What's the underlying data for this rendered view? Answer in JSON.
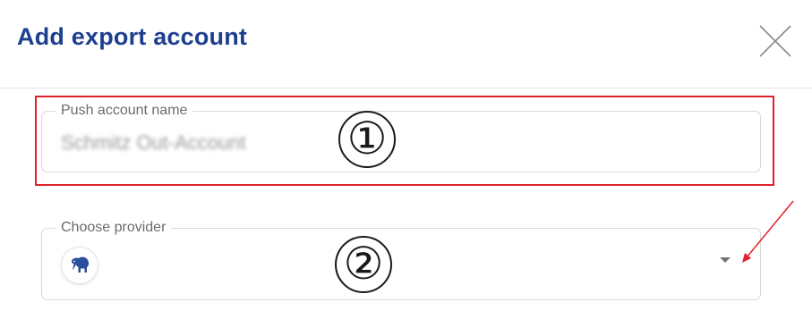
{
  "dialog": {
    "title": "Add export account",
    "close_icon": "close-icon"
  },
  "fields": {
    "account_name": {
      "label": "Push account name",
      "value": "Schmitz Out-Account"
    },
    "provider": {
      "label": "Choose provider",
      "selected_icon": "elephant-provider-icon",
      "dropdown_icon": "dropdown-arrow-icon"
    }
  },
  "annotations": {
    "callout_1": "①",
    "callout_2": "②",
    "highlight_color": "#e0212b",
    "arrow_color": "#e0212b"
  },
  "colors": {
    "title": "#1e3f8f",
    "icon_blue": "#2a4f9e"
  }
}
